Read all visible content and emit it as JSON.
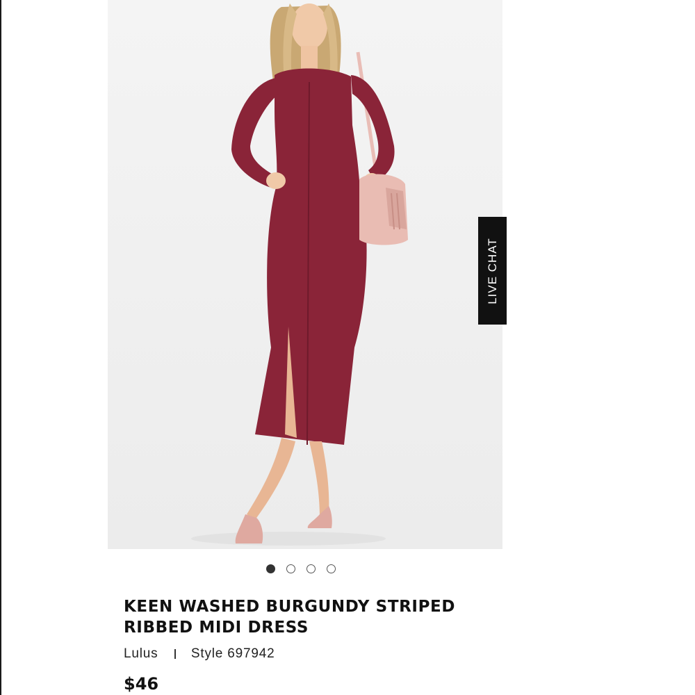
{
  "product": {
    "title": "KEEN WASHED BURGUNDY STRIPED RIBBED MIDI DRESS",
    "brand": "Lulus",
    "style": "Style 697942",
    "price": "$46"
  },
  "live_chat": {
    "label": "LIVE CHAT"
  },
  "carousel": {
    "count": 4,
    "active_index": 0
  },
  "colors": {
    "dress": "#8a2438",
    "background": "#ffffff",
    "live_chat_bg": "#111111"
  },
  "image": {
    "icon": "product-photo"
  }
}
